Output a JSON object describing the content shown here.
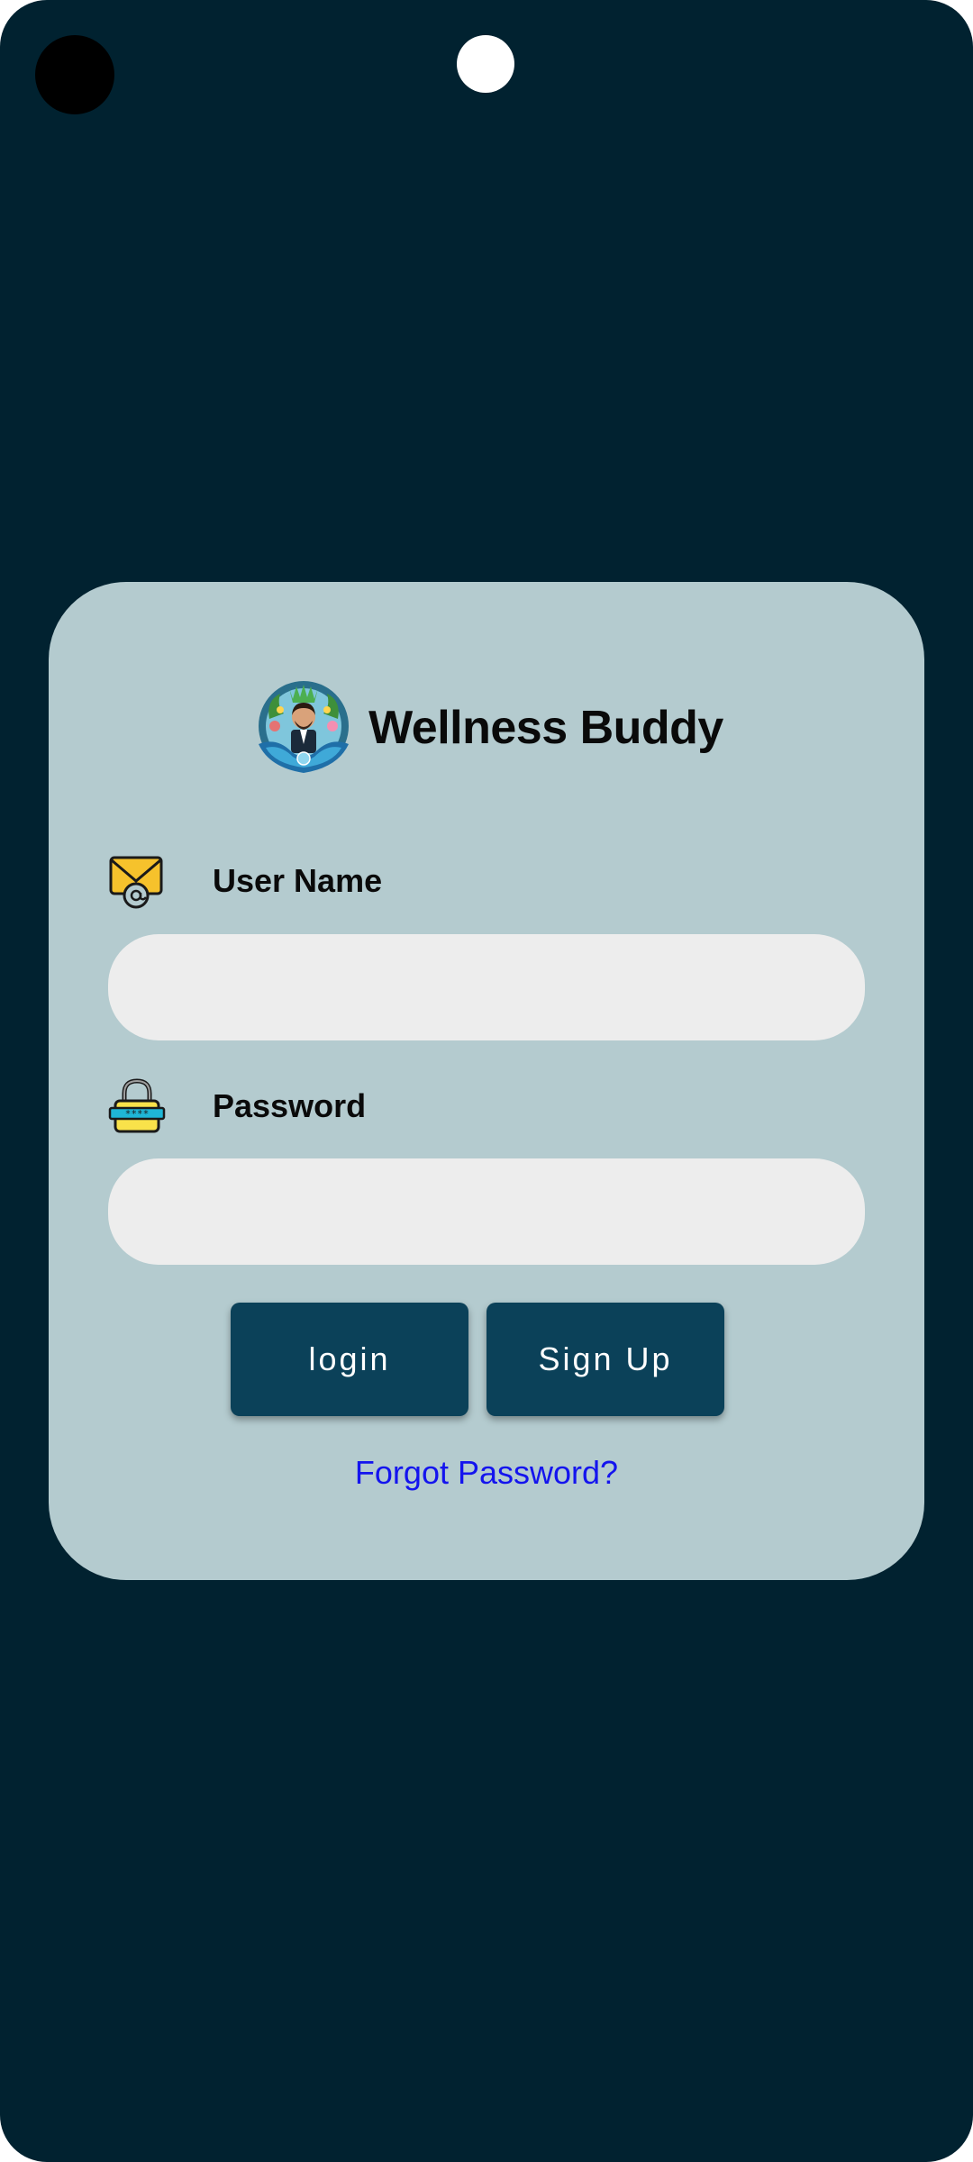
{
  "app": {
    "title": "Wellness Buddy",
    "logo_icon": "wellness-buddy-logo"
  },
  "form": {
    "username": {
      "label": "User Name",
      "icon": "email-icon",
      "value": "",
      "placeholder": ""
    },
    "password": {
      "label": "Password",
      "icon": "lock-icon",
      "value": "",
      "placeholder": ""
    }
  },
  "actions": {
    "login_label": "login",
    "signup_label": "Sign Up",
    "forgot_label": "Forgot Password?"
  },
  "colors": {
    "background": "#012230",
    "card": "#b4cbcf",
    "input": "#ededed",
    "button": "#0b4159",
    "link": "#1414ee"
  }
}
